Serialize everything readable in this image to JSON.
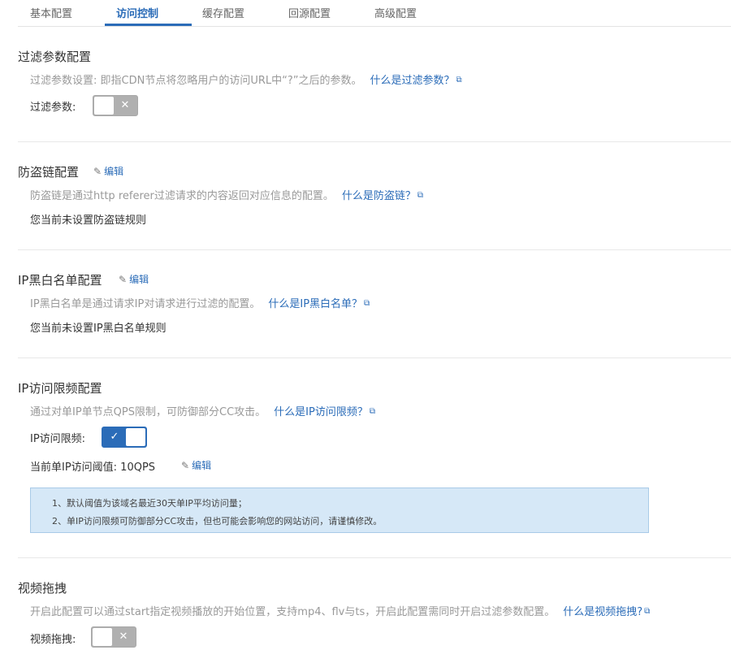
{
  "tabs": [
    {
      "label": "基本配置",
      "active": false
    },
    {
      "label": "访问控制",
      "active": true
    },
    {
      "label": "缓存配置",
      "active": false
    },
    {
      "label": "回源配置",
      "active": false
    },
    {
      "label": "高级配置",
      "active": false
    }
  ],
  "filter": {
    "title": "过滤参数配置",
    "desc": "过滤参数设置: 即指CDN节点将忽略用户的访问URL中“?”之后的参数。",
    "help": "什么是过滤参数？",
    "label": "过滤参数:",
    "toggle": {
      "state": "off",
      "mark": "✕"
    }
  },
  "hotlink": {
    "title": "防盗链配置",
    "edit": "编辑",
    "desc": "防盗链是通过http referer过滤请求的内容返回对应信息的配置。",
    "help": "什么是防盗链？",
    "status": "您当前未设置防盗链规则"
  },
  "ipblack": {
    "title": "IP黑白名单配置",
    "edit": "编辑",
    "desc": "IP黑白名单是通过请求IP对请求进行过滤的配置。",
    "help": "什么是IP黑白名单？",
    "status": "您当前未设置IP黑白名单规则"
  },
  "iplimit": {
    "title": "IP访问限频配置",
    "desc": "通过对单IP单节点QPS限制，可防御部分CC攻击。",
    "help": "什么是IP访问限频？",
    "label": "IP访问限频:",
    "toggle": {
      "state": "on",
      "mark": "✓"
    },
    "threshold": "当前单IP访问阈值: 10QPS",
    "edit": "编辑",
    "notice": [
      "1、默认阈值为该域名最近30天单IP平均访问量；",
      "2、单IP访问限频可防御部分CC攻击，但也可能会影响您的网站访问，请谨慎修改。"
    ]
  },
  "video": {
    "title": "视频拖拽",
    "desc": "开启此配置可以通过start指定视频播放的开始位置，支持mp4、flv与ts，开启此配置需同时开启过滤参数配置。",
    "help": "什么是视频拖拽?",
    "label": "视频拖拽:",
    "toggle": {
      "state": "off",
      "mark": "✕"
    }
  },
  "icons": {
    "external": "⧉",
    "pencil": "✎"
  },
  "colors": {
    "accent": "#2b6cb8",
    "toggle_off": "#b0b0b0",
    "notice_bg": "#d6e8f7"
  }
}
